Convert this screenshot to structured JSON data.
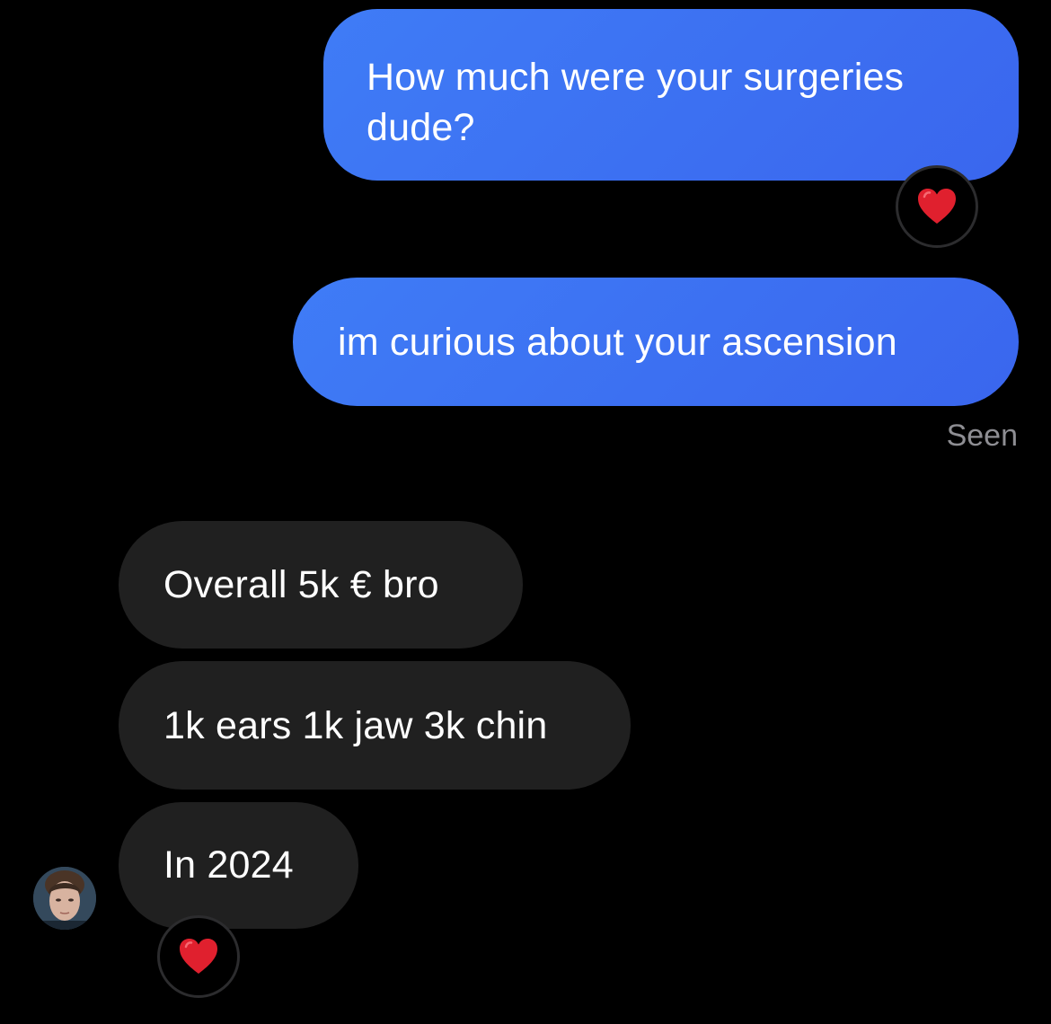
{
  "conversation": {
    "messages": [
      {
        "from": "me",
        "text": "How much were your surgeries dude?",
        "reaction": "red-heart"
      },
      {
        "from": "me",
        "text": "im curious about your ascension"
      },
      {
        "from": "them",
        "text": "Overall 5k € bro"
      },
      {
        "from": "them",
        "text": "1k ears 1k jaw 3k chin"
      },
      {
        "from": "them",
        "text": "In 2024",
        "reaction": "red-heart"
      }
    ],
    "status": "Seen"
  },
  "colors": {
    "background": "#000000",
    "sent_bubble": "#3d72f3",
    "received_bubble": "#202020",
    "status_text": "#8e8e93",
    "heart": "#e0202e"
  },
  "icons": {
    "reaction": "red-heart-icon",
    "avatar": "contact-avatar"
  }
}
